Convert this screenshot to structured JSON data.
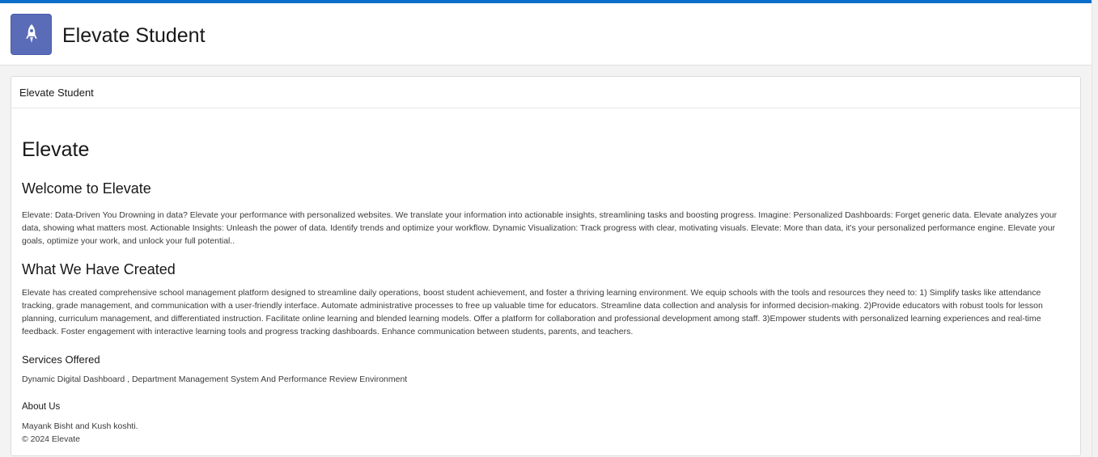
{
  "app": {
    "title": "Elevate Student",
    "icon": "rocket-icon",
    "accent_color": "#0b6ec9",
    "icon_bg_color": "#5a6bb7"
  },
  "card": {
    "header_label": "Elevate Student"
  },
  "content": {
    "heading": "Elevate",
    "welcome_heading": "Welcome to Elevate",
    "welcome_text": "Elevate: Data-Driven You Drowning in data? Elevate your performance with personalized websites. We translate your information into actionable insights, streamlining tasks and boosting progress. Imagine: Personalized Dashboards: Forget generic data. Elevate analyzes your data, showing what matters most. Actionable Insights: Unleash the power of data. Identify trends and optimize your workflow. Dynamic Visualization: Track progress with clear, motivating visuals. Elevate: More than data, it's your personalized performance engine. Elevate your goals, optimize your work, and unlock your full potential..",
    "created_heading": "What We Have Created",
    "created_text": "Elevate has created comprehensive school management platform designed to streamline daily operations, boost student achievement, and foster a thriving learning environment. We equip schools with the tools and resources they need to: 1) Simplify tasks like attendance tracking, grade management, and communication with a user-friendly interface. Automate administrative processes to free up valuable time for educators. Streamline data collection and analysis for informed decision-making. 2)Provide educators with robust tools for lesson planning, curriculum management, and differentiated instruction. Facilitate online learning and blended learning models. Offer a platform for collaboration and professional development among staff. 3)Empower students with personalized learning experiences and real-time feedback. Foster engagement with interactive learning tools and progress tracking dashboards. Enhance communication between students, parents, and teachers.",
    "services_heading": "Services Offered",
    "services_text": "Dynamic Digital Dashboard , Department Management System And Performance Review Environment",
    "about_heading": "About Us",
    "about_text": "Mayank Bisht and Kush koshti.",
    "copyright": "© 2024 Elevate"
  }
}
